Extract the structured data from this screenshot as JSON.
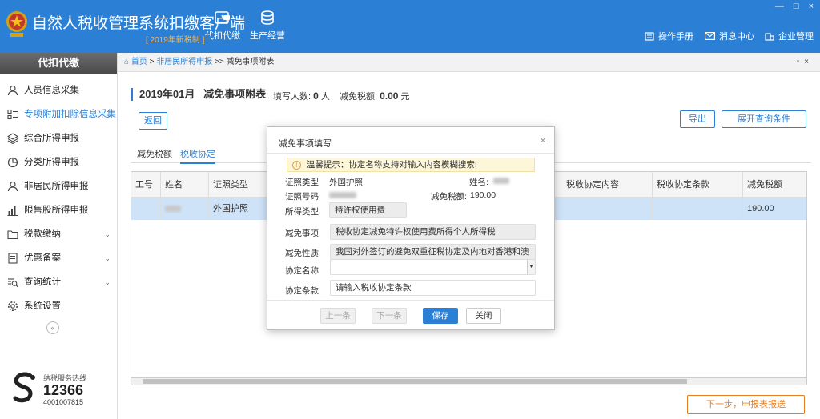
{
  "header": {
    "title": "自然人税收管理系统扣缴客户端",
    "subtitle": "[ 2019年新税制 ]",
    "nav": [
      {
        "label": "代扣代缴",
        "icon": "wallet-icon"
      },
      {
        "label": "生产经营",
        "icon": "coins-icon"
      }
    ],
    "right_nav": [
      {
        "label": "操作手册",
        "icon": "manual-icon"
      },
      {
        "label": "消息中心",
        "icon": "mail-icon"
      },
      {
        "label": "企业管理",
        "icon": "building-icon"
      }
    ],
    "window_controls": [
      "—",
      "□",
      "×"
    ]
  },
  "sidebar": {
    "header": "代扣代缴",
    "items": [
      {
        "label": "人员信息采集",
        "icon": "person-icon",
        "active": false,
        "chevron": ""
      },
      {
        "label": "专项附加扣除信息采集",
        "icon": "list-icon",
        "active": true,
        "chevron": "⌄"
      },
      {
        "label": "综合所得申报",
        "icon": "layers-icon",
        "active": false,
        "chevron": ""
      },
      {
        "label": "分类所得申报",
        "icon": "pie-icon",
        "active": false,
        "chevron": ""
      },
      {
        "label": "非居民所得申报",
        "icon": "person-icon",
        "active": false,
        "chevron": ""
      },
      {
        "label": "限售股所得申报",
        "icon": "bar-icon",
        "active": false,
        "chevron": ""
      },
      {
        "label": "税款缴纳",
        "icon": "folder-icon",
        "active": false,
        "chevron": "⌄"
      },
      {
        "label": "优惠备案",
        "icon": "doc-icon",
        "active": false,
        "chevron": "⌄"
      },
      {
        "label": "查询统计",
        "icon": "search-list-icon",
        "active": false,
        "chevron": "⌄"
      },
      {
        "label": "系统设置",
        "icon": "gear-icon",
        "active": false,
        "chevron": ""
      }
    ],
    "collapse": "«",
    "hotline": {
      "label": "纳税服务热线",
      "number": "12366",
      "number2": "4001007815"
    }
  },
  "breadcrumb": {
    "home": "首页",
    "sep1": ">",
    "parent": "非居民所得申报",
    "sep2": ">>",
    "current": "减免事项附表",
    "controls": "▫×"
  },
  "main": {
    "title_period": "2019年01月",
    "title_name": "减免事项附表",
    "count_label": "填写人数:",
    "count_value": "0",
    "count_unit": "人",
    "amount_label": "减免税额:",
    "amount_value": "0.00",
    "amount_unit": "元",
    "back_button": "返回",
    "export_button": "导出",
    "expand_button": "展开查询条件",
    "tabs": [
      {
        "label": "减免税额",
        "active": false
      },
      {
        "label": "税收协定",
        "active": true
      }
    ],
    "columns": [
      "工号",
      "姓名",
      "证照类型",
      "税收协定内容",
      "税收协定条款",
      "减免税额"
    ],
    "row": {
      "id_type": "外国护照",
      "amount": "190.00"
    },
    "next_button": "下一步，申报表报送"
  },
  "dialog": {
    "title": "减免事项填写",
    "close": "×",
    "tip": "温馨提示：协定名称支持对输入内容模糊搜索!",
    "id_type_label": "证照类型:",
    "id_type_value": "外国护照",
    "name_label": "姓名:",
    "id_no_label": "证照号码:",
    "amount_label": "减免税额:",
    "amount_value": "190.00",
    "income_type_label": "所得类型:",
    "income_type_value": "特许权使用费",
    "matter_label": "减免事项:",
    "matter_value": "税收协定减免特许权使用费所得个人所得税",
    "nature_label": "减免性质:",
    "nature_value": "我国对外签订的避免双重征税协定及内地对香港和澳",
    "agreement_label": "协定名称:",
    "agreement_value": "",
    "clause_label": "协定条款:",
    "clause_placeholder": "请输入税收协定条款",
    "prev_button": "上一条",
    "next_button": "下一条",
    "save_button": "保存",
    "close_button": "关闭"
  },
  "colors": {
    "primary": "#2b80d5",
    "accent": "#e67e22",
    "row_selected": "#cfe3f8"
  }
}
